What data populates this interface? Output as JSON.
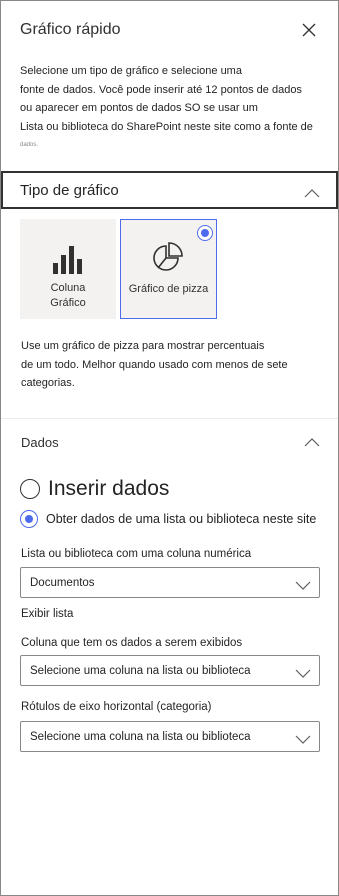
{
  "header": {
    "title": "Gráfico rápido",
    "close_icon": "close-icon"
  },
  "description": {
    "line1": "Selecione um tipo de gráfico e selecione uma",
    "line2": "fonte de dados. Você pode inserir até 12 pontos de dados",
    "line3": "ou aparecer em pontos de dados SO se usar um",
    "line4": "Lista ou biblioteca do SharePoint neste site como a fonte de",
    "line5": "dados."
  },
  "chart_type_section": {
    "label": "Tipo de gráfico",
    "tiles": [
      {
        "label_line1": "Coluna",
        "label_line2": "Gráfico",
        "icon": "bar-chart-icon",
        "selected": false
      },
      {
        "label": "Gráfico de pizza",
        "icon": "pie-chart-icon",
        "selected": true
      }
    ],
    "pie_description": {
      "line1": "Use um gráfico de pizza para mostrar percentuais",
      "line2": "de um todo. Melhor quando usado com menos de sete",
      "line3": "categorias."
    }
  },
  "data_section": {
    "label": "Dados",
    "options": [
      {
        "label": "Inserir dados",
        "selected": false
      },
      {
        "label": "Obter dados de uma lista ou biblioteca neste site",
        "selected": true
      }
    ],
    "list_label": "Lista ou biblioteca com uma coluna numérica",
    "list_value": "Documentos",
    "show_list": "Exibir lista",
    "column_label": "Coluna que tem os dados a serem exibidos",
    "column_value": "Selecione uma coluna na lista ou biblioteca",
    "axis_label": "Rótulos de eixo horizontal (categoria)",
    "axis_value": "Selecione uma coluna na lista ou biblioteca"
  },
  "colors": {
    "accent": "#4f6bed",
    "text": "#252423",
    "border": "#8a8886",
    "tile_bg": "#f3f2f1"
  }
}
